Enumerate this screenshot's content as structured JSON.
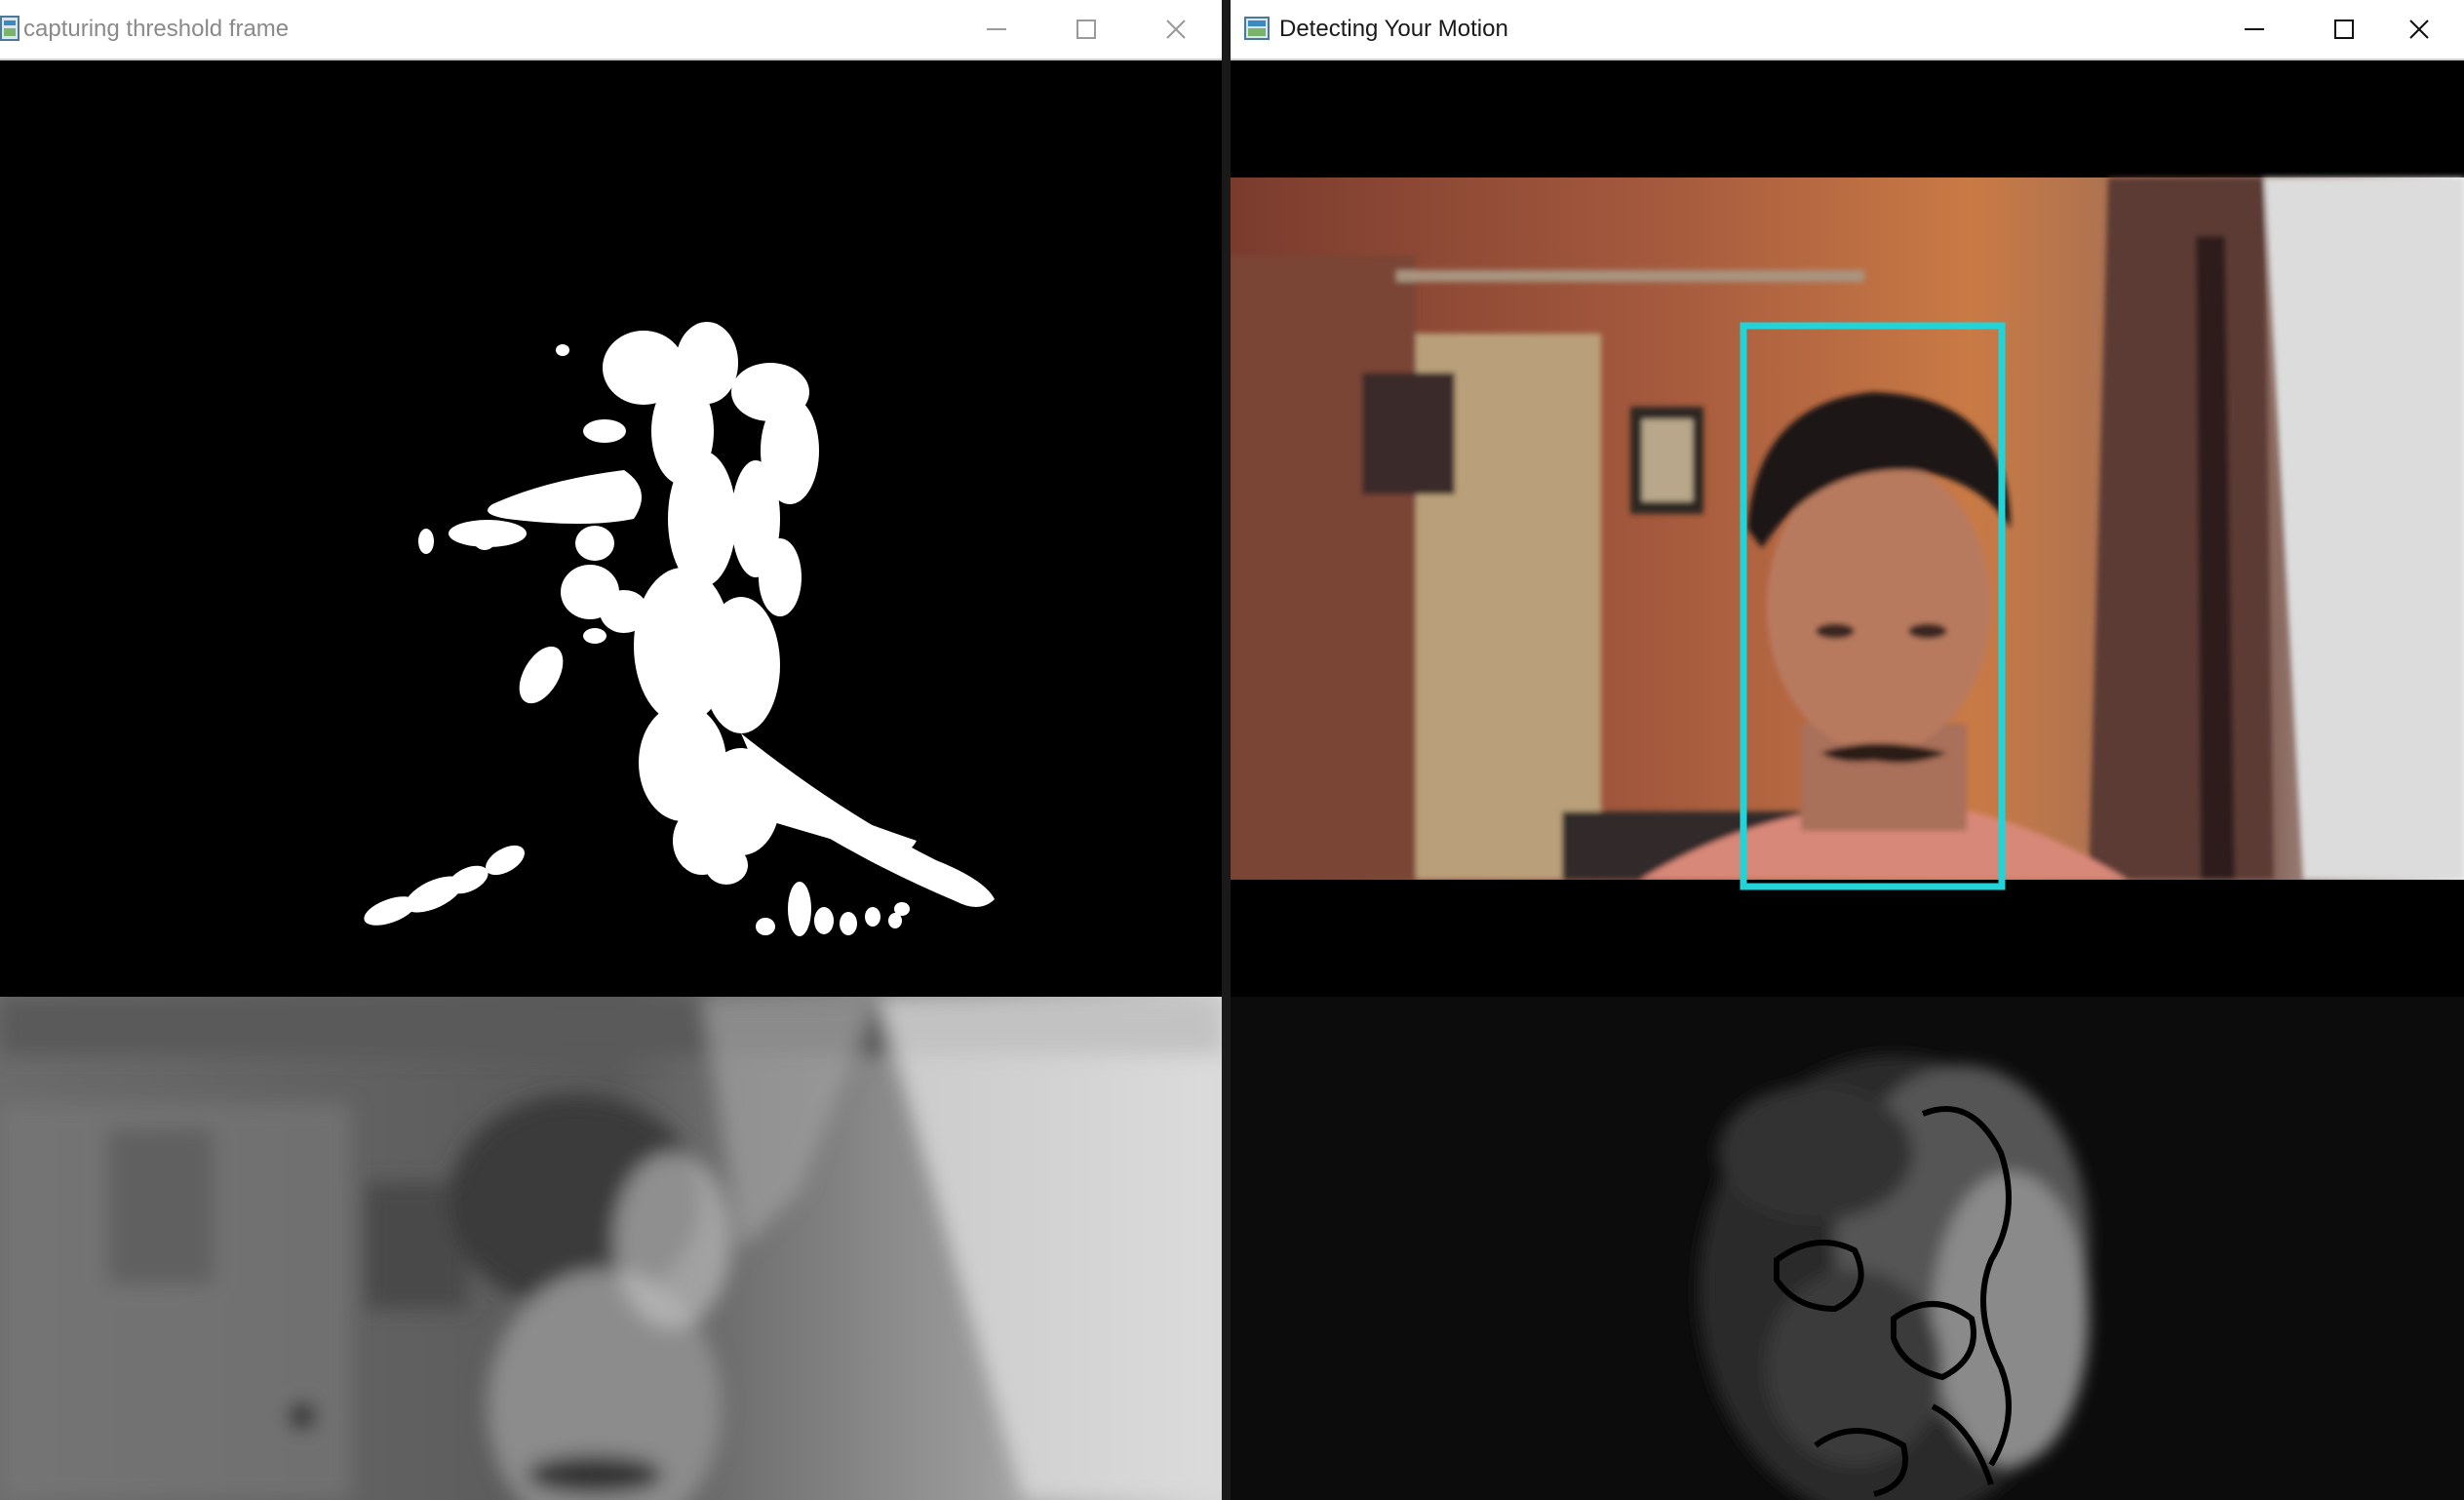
{
  "windows": {
    "threshold": {
      "title": "capturing threshold frame",
      "title_color": "#8a8a8a"
    },
    "motion": {
      "title": "Detecting Your Motion",
      "title_color": "#1a1a1a",
      "bounding_box_color": "#22d3d8"
    }
  },
  "colors": {
    "titlebar_bg": "#ffffff",
    "frame_bg": "#000000",
    "mask_white": "#ffffff"
  },
  "icons": {
    "minimize": "minimize-icon",
    "maximize": "maximize-icon",
    "close": "close-icon",
    "app": "opencv-window-icon"
  }
}
